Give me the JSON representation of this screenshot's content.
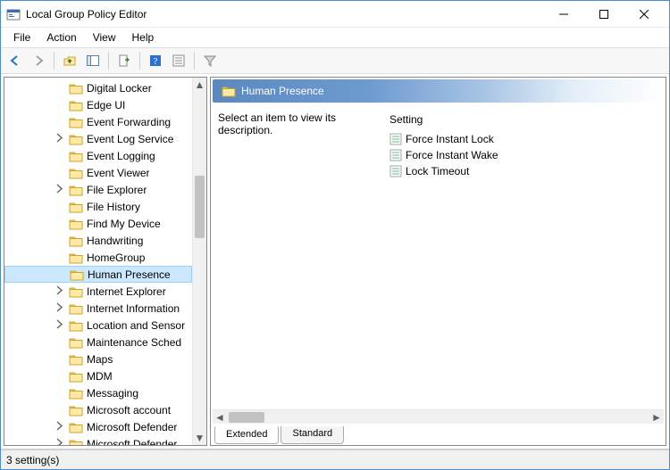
{
  "window": {
    "title": "Local Group Policy Editor"
  },
  "menu": {
    "file": "File",
    "action": "Action",
    "view": "View",
    "help": "Help"
  },
  "tree": {
    "items": [
      {
        "label": "Digital Locker",
        "expandable": false
      },
      {
        "label": "Edge UI",
        "expandable": false
      },
      {
        "label": "Event Forwarding",
        "expandable": false
      },
      {
        "label": "Event Log Service",
        "expandable": true
      },
      {
        "label": "Event Logging",
        "expandable": false
      },
      {
        "label": "Event Viewer",
        "expandable": false
      },
      {
        "label": "File Explorer",
        "expandable": true
      },
      {
        "label": "File History",
        "expandable": false
      },
      {
        "label": "Find My Device",
        "expandable": false
      },
      {
        "label": "Handwriting",
        "expandable": false
      },
      {
        "label": "HomeGroup",
        "expandable": false
      },
      {
        "label": "Human Presence",
        "expandable": false,
        "selected": true
      },
      {
        "label": "Internet Explorer",
        "expandable": true
      },
      {
        "label": "Internet Information",
        "expandable": true
      },
      {
        "label": "Location and Sensor",
        "expandable": true
      },
      {
        "label": "Maintenance Sched",
        "expandable": false
      },
      {
        "label": "Maps",
        "expandable": false
      },
      {
        "label": "MDM",
        "expandable": false
      },
      {
        "label": "Messaging",
        "expandable": false
      },
      {
        "label": "Microsoft account",
        "expandable": false
      },
      {
        "label": "Microsoft Defender",
        "expandable": true
      },
      {
        "label": "Microsoft Defender",
        "expandable": true
      }
    ]
  },
  "detail": {
    "header": "Human Presence",
    "description": "Select an item to view its description.",
    "settings_header": "Setting",
    "settings": [
      {
        "label": "Force Instant Lock"
      },
      {
        "label": "Force Instant Wake"
      },
      {
        "label": "Lock Timeout"
      }
    ]
  },
  "tabs": {
    "extended": "Extended",
    "standard": "Standard"
  },
  "status": {
    "text": "3 setting(s)"
  }
}
